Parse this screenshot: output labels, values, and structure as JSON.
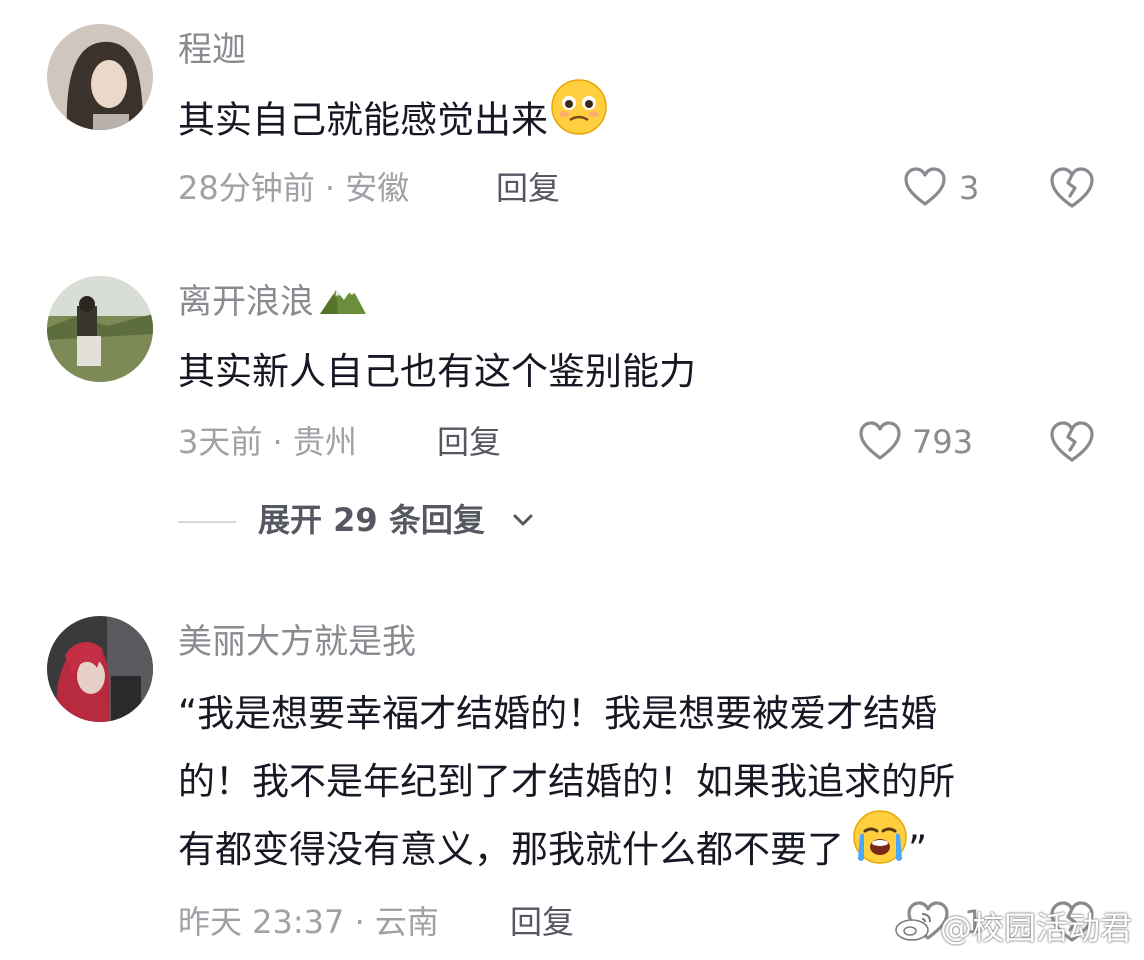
{
  "comments": [
    {
      "username": "程迦",
      "text": "其实自己就能感觉出来",
      "meta": "28分钟前 · 安徽",
      "reply_label": "回复",
      "like_count": "3"
    },
    {
      "username": "离开浪浪",
      "text": "其实新人自己也有这个鉴别能力",
      "meta": "3天前 · 贵州",
      "reply_label": "回复",
      "like_count": "793",
      "expand_label": "展开 29 条回复"
    },
    {
      "username": "美丽大方就是我",
      "text_lines": [
        "“我是想要幸福才结婚的！我是想要被爱才结婚",
        "的！我不是年纪到了才结婚的！如果我追求的所",
        "有都变得没有意义，那我就什么都不要了"
      ],
      "text_end": "”",
      "meta": "昨天 23:37 · 云南",
      "reply_label": "回复",
      "like_count": "1"
    }
  ],
  "watermark": "@校园活动君",
  "icons": {
    "like": "heart-outline-icon",
    "dislike": "broken-heart-icon",
    "expand": "chevron-down-icon",
    "emoji_1": "pleading-face-emoji-icon",
    "emoji_3": "crying-face-emoji-icon",
    "username_badge": "mountain-icon",
    "watermark_logo": "weibo-logo-icon"
  },
  "colors": {
    "background": "#ffffff",
    "username": "#8a8b91",
    "text": "#161823",
    "meta": "#a0a1a6",
    "reply": "#555761"
  }
}
